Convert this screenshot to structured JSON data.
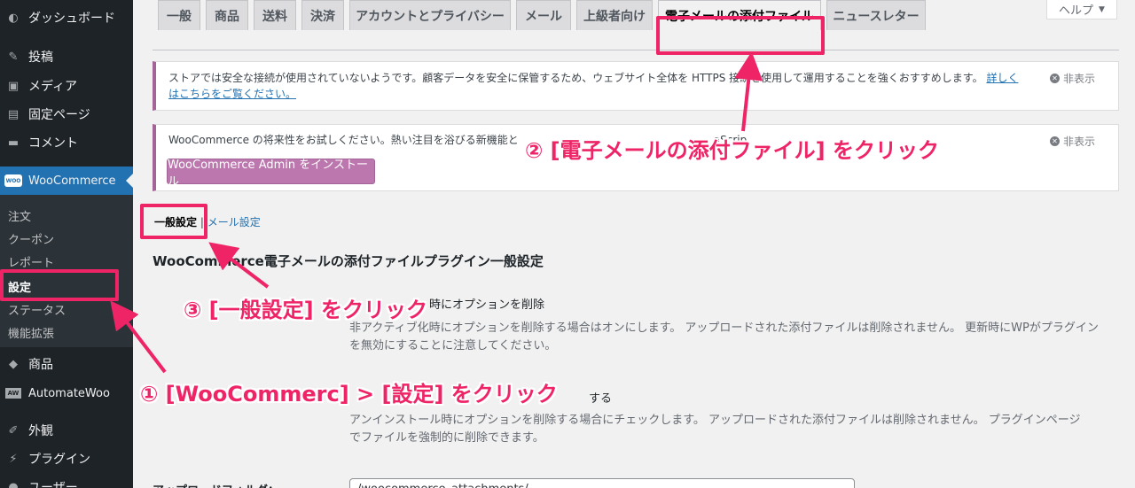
{
  "sidebar": {
    "items": [
      {
        "label": "ダッシュボード",
        "icon": "dashboard-icon"
      },
      {
        "label": "投稿",
        "icon": "pin-icon"
      },
      {
        "label": "メディア",
        "icon": "media-icon"
      },
      {
        "label": "固定ページ",
        "icon": "page-icon"
      },
      {
        "label": "コメント",
        "icon": "comment-icon"
      },
      {
        "label": "WooCommerce",
        "icon": "woo-icon",
        "logo_text": "WOO"
      },
      {
        "label": "商品",
        "icon": "box-icon"
      },
      {
        "label": "AutomateWoo",
        "icon": "aw-icon",
        "logo_text": "AW"
      },
      {
        "label": "外観",
        "icon": "brush-icon"
      },
      {
        "label": "プラグイン",
        "icon": "plug-icon"
      },
      {
        "label": "ユーザー",
        "icon": "user-icon"
      }
    ],
    "submenu": [
      "注文",
      "クーポン",
      "レポート",
      "設定",
      "ステータス",
      "機能拡張"
    ]
  },
  "help": {
    "label": "ヘルプ"
  },
  "tabs": [
    "一般",
    "商品",
    "送料",
    "決済",
    "アカウントとプライバシー",
    "メール",
    "上級者向け",
    "電子メールの添付ファイル",
    "ニュースレター"
  ],
  "notices": {
    "https": {
      "text": "ストアでは安全な接続が使用されていないようです。顧客データを安全に保管するため、ウェブサイト全体を HTTPS 接続を使用して運用することを強くおすすめします。",
      "link": "詳しく",
      "link2": "はこちらをご覧ください。",
      "dismiss": "非表示"
    },
    "admin": {
      "text": "WooCommerce の将来性をお試しください。熱い注目を浴びる新機能と",
      "text_tail": "aScrip",
      "button": "WooCommerce Admin をインストール",
      "dismiss": "非表示"
    }
  },
  "subsub": {
    "current": "一般設定",
    "sep": "|",
    "link": "メール設定"
  },
  "section_title": "WooCommerce電子メールの添付ファイルプラグイン一般設定",
  "fields": {
    "deactivate_label_tail": "時にオプションを削除",
    "deactivate_desc_1": "非アクティブ化時にオプションを削除する場合はオンにします。 アップロードされた添付ファイルは削除されません。 更新時にWPがプラグイン",
    "deactivate_desc_2": "を無効にすることに注意してください。",
    "uninstall_label_tail": "する",
    "uninstall_desc_1": "アンインストール時にオプションを削除する場合にチェックします。 アップロードされた添付ファイルは削除されません。 プラグインページ",
    "uninstall_desc_2": "でファイルを強制的に削除できます。",
    "upload_label": "アップロードフォルダ：",
    "upload_value": "/woocommerce_attachments/"
  },
  "annotations": {
    "step1": "① [WooCommerc] > [設定] をクリック",
    "step2": "② [電子メールの添付ファイル] をクリック",
    "step3": "③ [一般設定] をクリック",
    "color": "#ee2466"
  }
}
